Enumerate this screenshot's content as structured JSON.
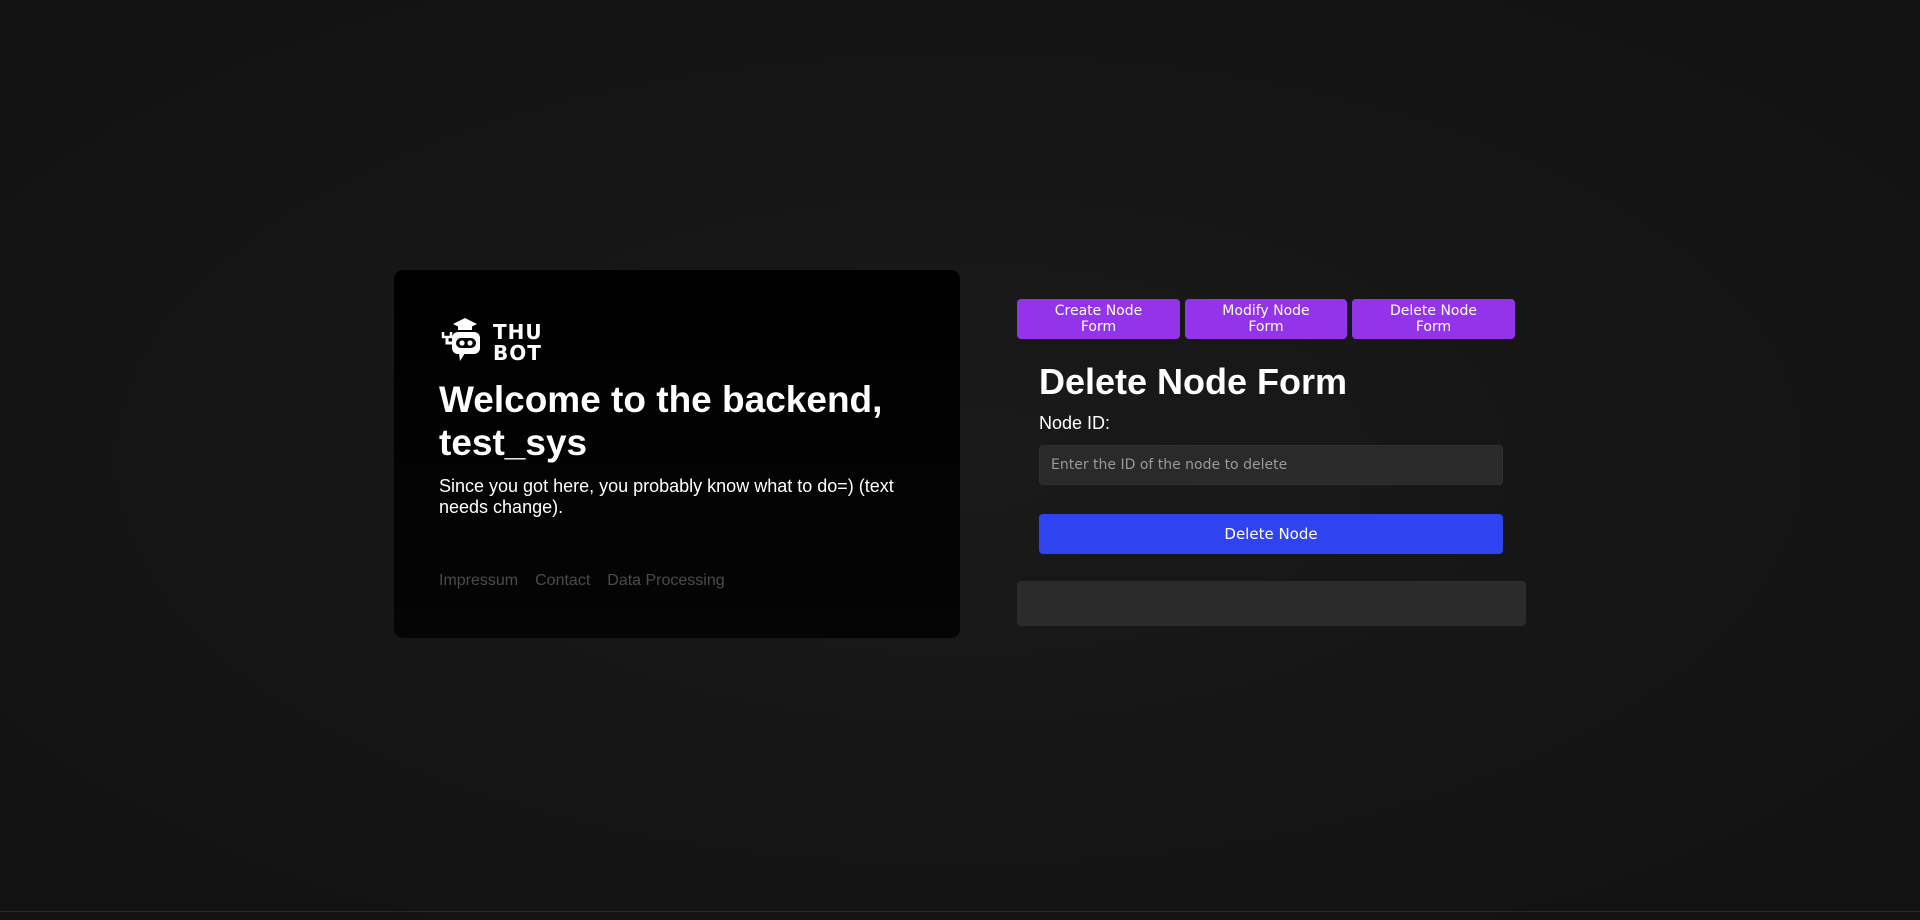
{
  "logo": {
    "icon": "robot-graduate-icon",
    "line1": "THU",
    "line2": "BOT"
  },
  "welcome": {
    "title_line1": "Welcome to the backend,",
    "title_line2": "test_sys",
    "text": "Since you got here, you probably know what to do=) (text needs change)."
  },
  "footer": {
    "links": [
      "Impressum",
      "Contact",
      "Data Processing"
    ]
  },
  "tabs": [
    {
      "label": "Create Node Form"
    },
    {
      "label": "Modify Node Form"
    },
    {
      "label": "Delete Node Form"
    }
  ],
  "form": {
    "title": "Delete Node Form",
    "node_id_label": "Node ID:",
    "node_id_value": "",
    "node_id_placeholder": "Enter the ID of the node to delete",
    "submit_label": "Delete Node"
  },
  "result": {
    "text": ""
  },
  "colors": {
    "tab_bg": "#9333ea",
    "submit_bg": "#2f44f0",
    "page_bg": "#151515",
    "card_bg": "#000000",
    "footer_link": "#4b4b4b"
  }
}
